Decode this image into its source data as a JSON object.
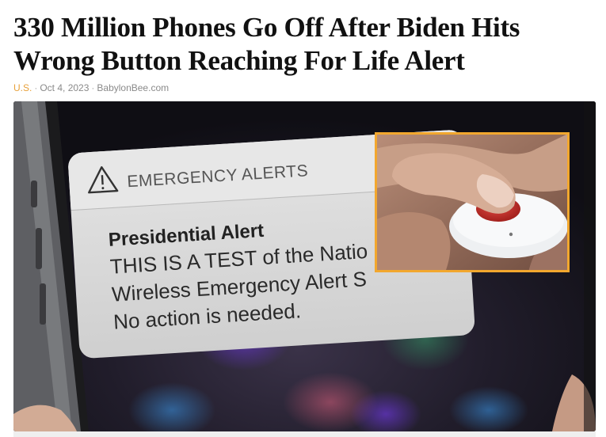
{
  "article": {
    "headline_line1": "330 Million Phones Go Off After Biden Hits",
    "headline_line2": "Wrong Button Reaching For Life Alert",
    "category": "U.S.",
    "separator": "·",
    "date": "Oct 4, 2023",
    "source": "BabylonBee.com"
  },
  "hero_image": {
    "notification": {
      "header_icon": "warning-triangle-icon",
      "header": "EMERGENCY ALERTS",
      "title": "Presidential Alert",
      "line1": "THIS IS A TEST of the Natio",
      "line2": "Wireless Emergency Alert S",
      "line3": "No action is needed."
    },
    "inset": {
      "subject": "life-alert-button-pressed-by-finger",
      "border_color": "#f2a72e"
    }
  },
  "colors": {
    "category_accent": "#e8a13a",
    "meta_text": "#8a8a8a",
    "headline_text": "#111111"
  }
}
